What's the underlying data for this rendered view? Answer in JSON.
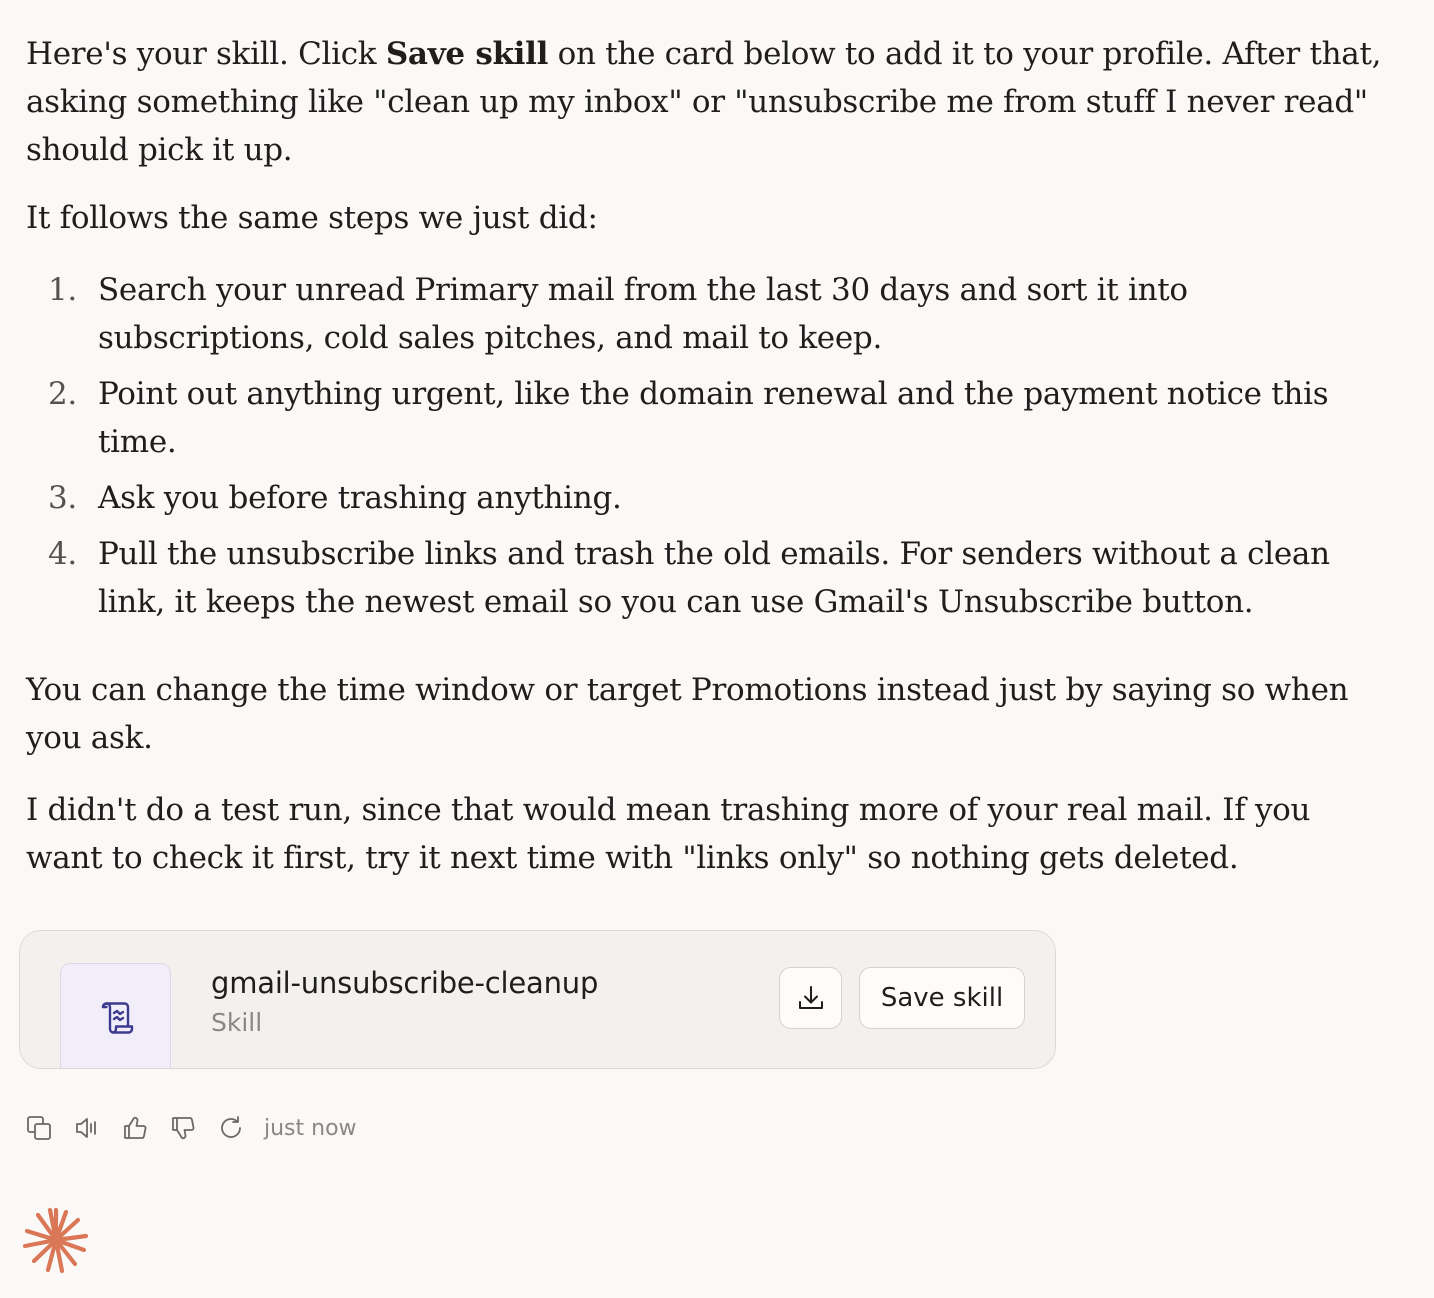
{
  "message": {
    "intro": {
      "before": "Here's your skill. Click ",
      "bold": "Save skill",
      "after": " on the card below to add it to your profile. After that, asking something like \"clean up my inbox\" or \"unsubscribe me from stuff I never read\" should pick it up."
    },
    "steps_lead": "It follows the same steps we just did:",
    "steps": [
      {
        "num": "1.",
        "text": "Search your unread Primary mail from the last 30 days and sort it into subscriptions, cold sales pitches, and mail to keep."
      },
      {
        "num": "2.",
        "text": "Point out anything urgent, like the domain renewal and the payment notice this time."
      },
      {
        "num": "3.",
        "text": "Ask you before trashing anything."
      },
      {
        "num": "4.",
        "text": "Pull the unsubscribe links and trash the old emails. For senders without a clean link, it keeps the newest email so you can use Gmail's Unsubscribe button."
      }
    ],
    "paragraph_change": "You can change the time window or target Promotions instead just by saying so when you ask.",
    "paragraph_test": "I didn't do a test run, since that would mean trashing more of your real mail. If you want to check it first, try it next time with \"links only\" so nothing gets deleted."
  },
  "card": {
    "title": "gmail-unsubscribe-cleanup",
    "subtitle": "Skill",
    "thumb_icon": "scroll-icon",
    "download_icon": "download-icon",
    "save_label": "Save skill"
  },
  "actions": {
    "icons": [
      "copy-icon",
      "speaker-icon",
      "thumbs-up-icon",
      "thumbs-down-icon",
      "retry-icon"
    ],
    "timestamp": "just now"
  },
  "colors": {
    "background": "#faf9f8",
    "text": "#1f1e1d",
    "muted": "#8a8884",
    "logo": "#d97757",
    "thumb_accent": "#3b3a8f"
  }
}
